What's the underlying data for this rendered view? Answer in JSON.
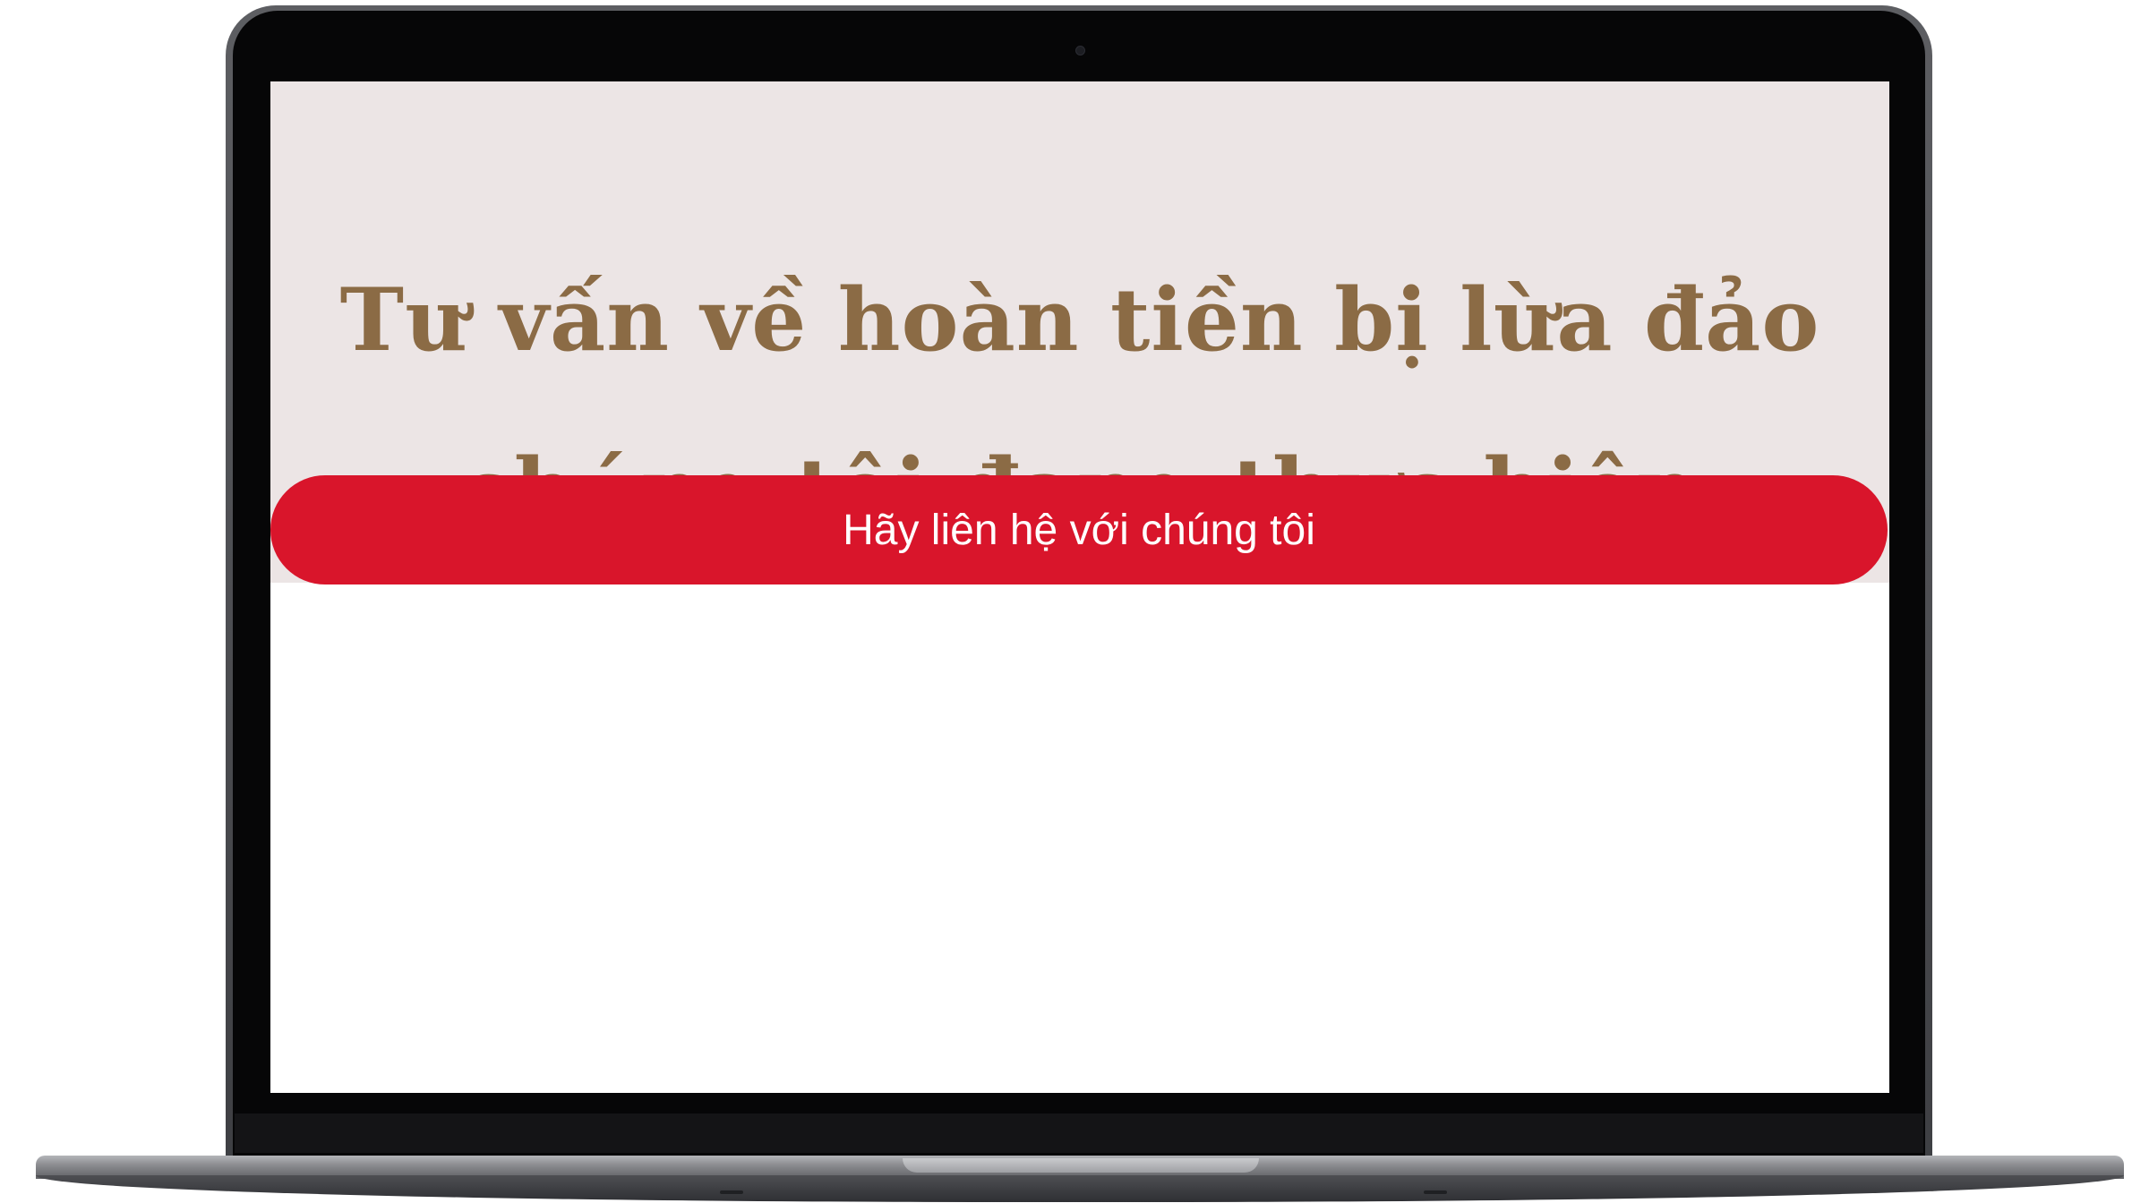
{
  "hero": {
    "title": "Tư vấn về hoàn tiền bị lừa đảo chúng tôi đang thực hiện"
  },
  "cta": {
    "label": "Hãy liên hệ với chúng tôi"
  },
  "colors": {
    "hero_background": "#ece5e5",
    "title_color": "#8b6b45",
    "cta_background": "#d9152b",
    "cta_text": "#ffffff"
  }
}
